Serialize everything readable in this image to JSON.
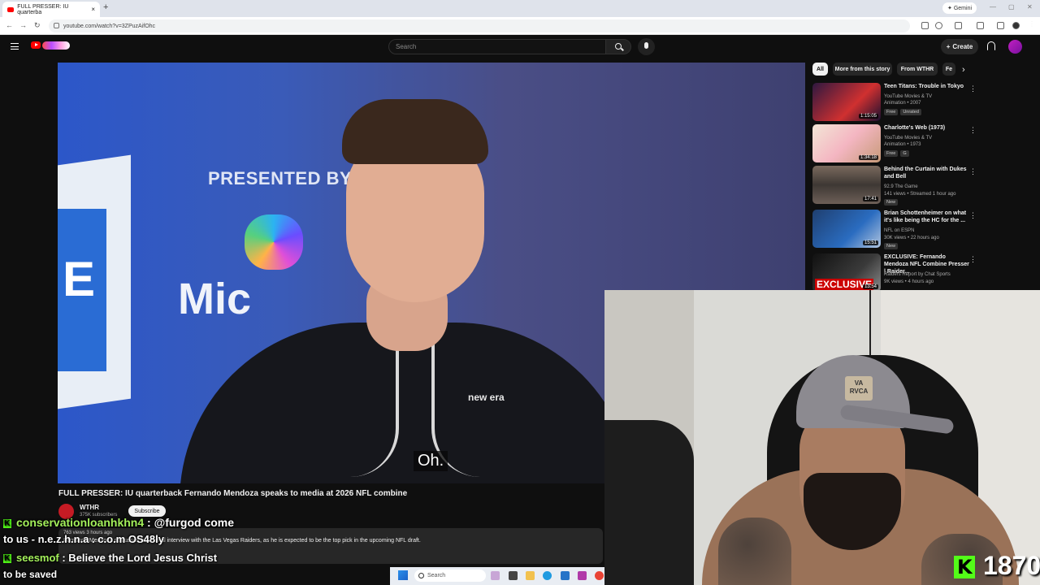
{
  "browser": {
    "tab_title": "FULL PRESSER: IU quarterba",
    "tab_close": "×",
    "new_tab": "+",
    "gemini_label": "Gemini",
    "url": "youtube.com/watch?v=3ZPuzAifOhc",
    "back": "←",
    "forward": "→",
    "reload": "↻",
    "min": "—",
    "max": "▢",
    "close": "✕"
  },
  "youtube": {
    "search_placeholder": "Search",
    "create_label": "Create",
    "create_plus": "+"
  },
  "video": {
    "presented_by": "PRESENTED BY",
    "mic_text": "Mic",
    "newera": "new era",
    "caption": "Oh.",
    "title": "FULL PRESSER: IU quarterback Fernando Mendoza speaks to media at 2026 NFL combine",
    "channel": "WTHR",
    "subscribers": "375K subscribers",
    "subscribe_label": "Subscribe",
    "views_age": "763 views  3 hours ago",
    "description": "Fernando Mendoza discusses his formal interview with the Las Vegas Raiders, as he is expected to be the top pick in the upcoming NFL draft."
  },
  "sidebar": {
    "chips": [
      "All",
      "More from this story",
      "From WTHR",
      "Fe"
    ],
    "next_icon": "›",
    "kebab": "⋮",
    "recommendations": [
      {
        "title": "Teen Titans: Trouble in Tokyo",
        "channel": "YouTube Movies & TV",
        "meta": "Animation • 2007",
        "duration": "1:15:05",
        "badges": [
          "Free",
          "Unrated"
        ],
        "thumb_color": "#2e1840"
      },
      {
        "title": "Charlotte's Web (1973)",
        "channel": "YouTube Movies & TV",
        "meta": "Animation • 1973",
        "duration": "1:34:18",
        "badges": [
          "Free",
          "G"
        ],
        "thumb_color": "#e8d6c4"
      },
      {
        "title": "Behind the Curtain with Dukes and Bell",
        "channel": "92.9 The Game",
        "meta": "141 views • Streamed 1 hour ago",
        "duration": "17:41",
        "badges": [
          "New"
        ],
        "thumb_color": "#5d5048"
      },
      {
        "title": "Brian Schottenheimer on what it's like being the HC for the ...",
        "channel": "NFL on ESPN",
        "meta": "30K views • 22 hours ago",
        "duration": "15:51",
        "badges": [
          "New"
        ],
        "thumb_color": "#2a4f86"
      },
      {
        "title": "EXCLUSIVE: Fernando Mendoza NFL Combine Presser | Raider...",
        "channel": "Raiders Report by Chat Sports",
        "meta": "9K views • 4 hours ago",
        "duration": "13:54",
        "badges": [],
        "thumb_color": "#1a1a1a",
        "thumb_text": "EXCLUSIVE"
      }
    ]
  },
  "webcam": {
    "cap_patch": "VA RVCA",
    "viewer_count": "1870"
  },
  "chat": [
    {
      "badge": "K",
      "user": "conservationloanhkhn4",
      "message": " : @furgod come"
    },
    {
      "message": "to us - n.e.z.h.n.a . c.o.m OS48ly"
    },
    {
      "badge": "K",
      "user": "seesmof",
      "message": " : Believe the Lord Jesus Christ"
    },
    {
      "message": "to be saved"
    }
  ],
  "taskbar": {
    "search_label": "Search"
  },
  "colors": {
    "kick_green": "#53fc18",
    "youtube_red": "#ff0000",
    "yt_bg": "#0f0f0f"
  }
}
